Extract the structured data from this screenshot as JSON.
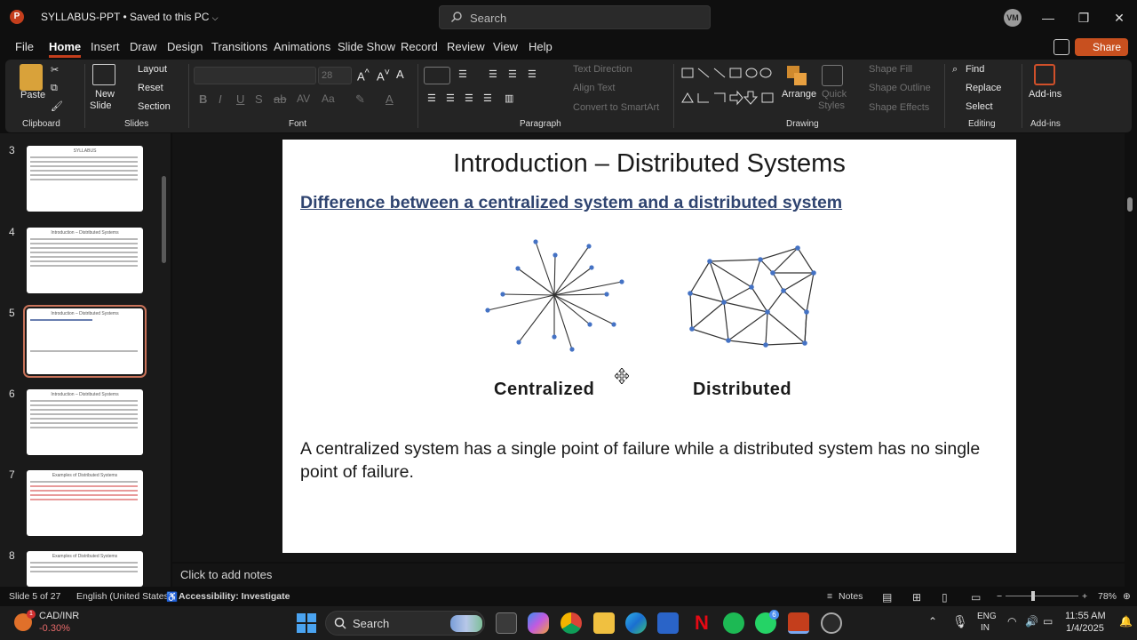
{
  "app": {
    "title": "SYLLABUS-PPT • Saved to this PC",
    "logo_letter": "P",
    "search_placeholder": "Search",
    "user_initials": "VM"
  },
  "menu": {
    "items": [
      "File",
      "Home",
      "Insert",
      "Draw",
      "Design",
      "Transitions",
      "Animations",
      "Slide Show",
      "Record",
      "Review",
      "View",
      "Help"
    ],
    "share_label": "Share"
  },
  "ribbon": {
    "clipboard": {
      "paste": "Paste",
      "group": "Clipboard"
    },
    "slides": {
      "new_slide": "New",
      "new_slide2": "Slide",
      "layout": "Layout",
      "reset": "Reset",
      "section": "Section",
      "group": "Slides"
    },
    "font": {
      "size": "28",
      "group": "Font",
      "bold": "B",
      "italic": "I",
      "underline": "U",
      "shadow": "S"
    },
    "paragraph": {
      "text_direction": "Text Direction",
      "align_text": "Align Text",
      "convert_smartart": "Convert to SmartArt",
      "group": "Paragraph"
    },
    "drawing": {
      "arrange": "Arrange",
      "quick_styles": "Quick",
      "quick_styles2": "Styles",
      "shape_fill": "Shape Fill",
      "shape_outline": "Shape Outline",
      "shape_effects": "Shape Effects",
      "group": "Drawing"
    },
    "editing": {
      "find": "Find",
      "replace": "Replace",
      "select": "Select",
      "group": "Editing"
    },
    "addins": {
      "label": "Add-ins",
      "group": "Add-ins"
    }
  },
  "thumbnails": [
    {
      "num": "3",
      "title": "SYLLABUS"
    },
    {
      "num": "4",
      "title": "Introduction – Distributed Systems"
    },
    {
      "num": "5",
      "title": "Introduction – Distributed Systems"
    },
    {
      "num": "6",
      "title": "Introduction – Distributed Systems"
    },
    {
      "num": "7",
      "title": "Examples of Distributed Systems"
    },
    {
      "num": "8",
      "title": "Examples of Distributed Systems"
    }
  ],
  "slide": {
    "title": "Introduction – Distributed Systems",
    "subtitle": "Difference between a centralized system and a distributed system",
    "label_centralized": "Centralized",
    "label_distributed": "Distributed",
    "body": "A centralized system has a single point of failure while a distributed system has no single point of failure."
  },
  "notes_placeholder": "Click to add notes",
  "status": {
    "slide": "Slide 5 of 27",
    "language": "English (United States)",
    "accessibility": "Accessibility: Investigate",
    "notes": "Notes",
    "zoom": "78%"
  },
  "taskbar": {
    "stock_name": "CAD/INR",
    "stock_change": "-0.30%",
    "stock_badge": "1",
    "search": "Search",
    "lang1": "ENG",
    "lang2": "IN",
    "time": "11:55 AM",
    "date": "1/4/2025",
    "whatsapp_badge": "6"
  },
  "colors": {
    "accent": "#c43e1c",
    "subtitle": "#2f4470",
    "node": "#4472c4"
  }
}
